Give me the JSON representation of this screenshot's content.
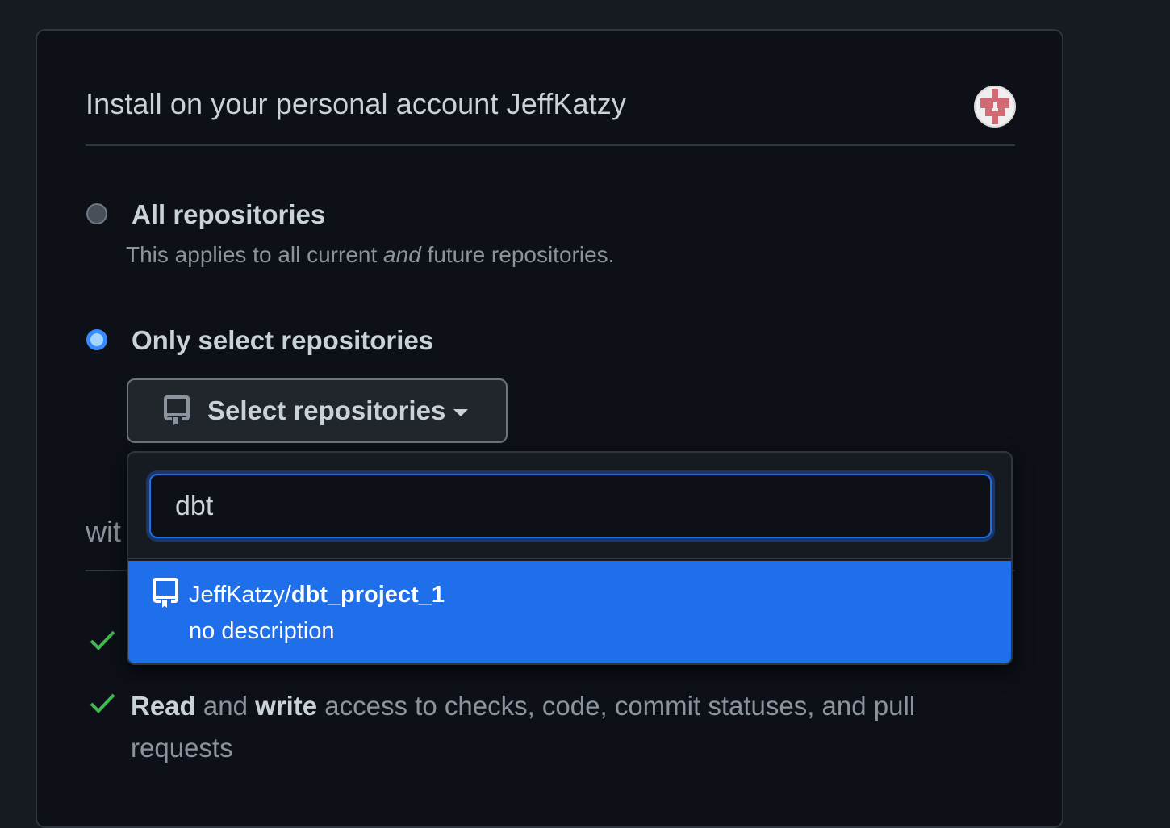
{
  "card": {
    "title": "Install on your personal account JeffKatzy"
  },
  "options": {
    "all": {
      "label": "All repositories",
      "desc_pre": "This applies to all current ",
      "desc_em": "and",
      "desc_post": " future repositories.",
      "selected": false
    },
    "select": {
      "label": "Only select repositories",
      "selected": true
    }
  },
  "select_button": {
    "label": "Select repositories",
    "icon": "repo-icon"
  },
  "dropdown": {
    "search_value": "dbt",
    "results": [
      {
        "owner": "JeffKatzy/",
        "repo": "dbt_project_1",
        "description": "no description",
        "icon": "repo-icon",
        "highlighted": true
      }
    ]
  },
  "behind": {
    "partial_heading": "wit"
  },
  "permissions": {
    "item2": {
      "read": "Read",
      "and": " and ",
      "write": "write",
      "rest": " access to checks, code, commit statuses, and pull requests"
    }
  },
  "colors": {
    "accent": "#1f6feb",
    "check": "#3fb950",
    "bg": "#0d1117"
  }
}
